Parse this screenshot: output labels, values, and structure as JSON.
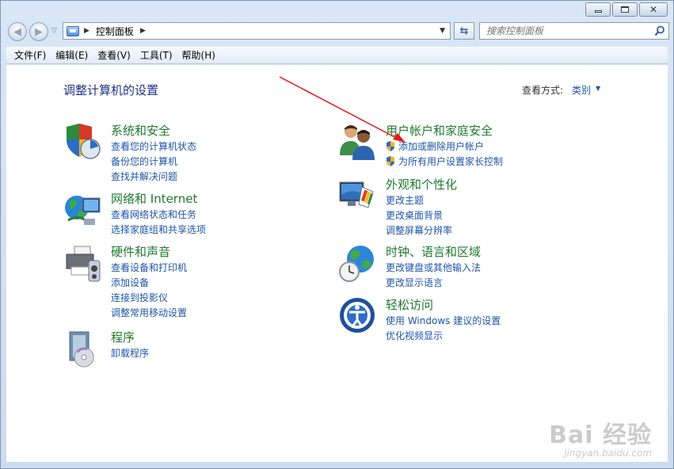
{
  "window": {
    "address": {
      "location": "控制面板"
    },
    "search": {
      "placeholder": "搜索控制面板"
    }
  },
  "menu": [
    "文件(F)",
    "编辑(E)",
    "查看(V)",
    "工具(T)",
    "帮助(H)"
  ],
  "content": {
    "title": "调整计算机的设置",
    "view_by_label": "查看方式:",
    "view_by_value": "类别"
  },
  "categories": {
    "system": {
      "title": "系统和安全",
      "icon": "shield-monitor-icon",
      "links": [
        "查看您的计算机状态",
        "备份您的计算机",
        "查找并解决问题"
      ]
    },
    "network": {
      "title": "网络和 Internet",
      "icon": "globe-network-icon",
      "links": [
        "查看网络状态和任务",
        "选择家庭组和共享选项"
      ]
    },
    "hardware": {
      "title": "硬件和声音",
      "icon": "printer-speaker-icon",
      "links": [
        "查看设备和打印机",
        "添加设备",
        "连接到投影仪",
        "调整常用移动设置"
      ]
    },
    "programs": {
      "title": "程序",
      "icon": "programs-disc-icon",
      "links": [
        "卸载程序"
      ]
    },
    "users": {
      "title": "用户帐户和家庭安全",
      "icon": "users-icon",
      "links": [
        "添加或删除用户帐户",
        "为所有用户设置家长控制"
      ]
    },
    "appearance": {
      "title": "外观和个性化",
      "icon": "monitor-palette-icon",
      "links": [
        "更改主题",
        "更改桌面背景",
        "调整屏幕分辨率"
      ]
    },
    "clock": {
      "title": "时钟、语言和区域",
      "icon": "globe-clock-icon",
      "links": [
        "更改键盘或其他输入法",
        "更改显示语言"
      ]
    },
    "ease": {
      "title": "轻松访问",
      "icon": "ease-of-access-icon",
      "links": [
        "使用 Windows 建议的设置",
        "优化视频显示"
      ]
    }
  },
  "watermark": {
    "brand": "Bai 经验",
    "url": "jingyan.baidu.com"
  },
  "colors": {
    "link": "#1e55a8",
    "category_title": "#1e7a2e",
    "page_title": "#1e3287",
    "annotation_arrow": "#e8161b"
  }
}
